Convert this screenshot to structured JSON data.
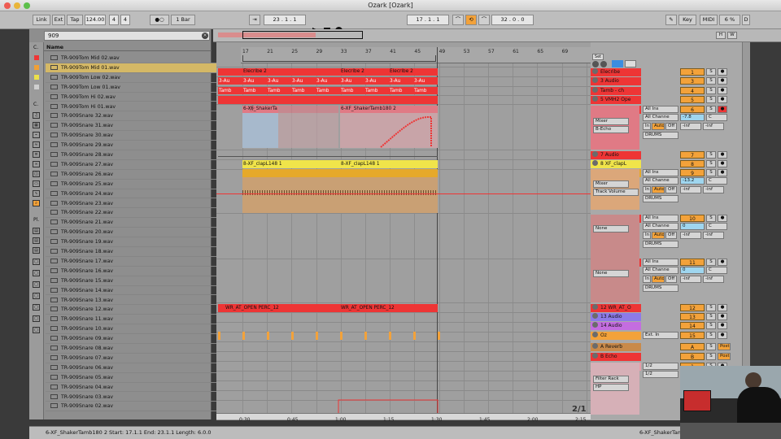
{
  "window": {
    "title": "Ozark  [Ozark]"
  },
  "control": {
    "link": "Link",
    "ext": "Ext",
    "tap": "Tap",
    "tempo": "124.00",
    "sig_num": "4",
    "sig_den": "4",
    "quant": "1 Bar",
    "pos1": "23 . 1 . 1",
    "pos2": "17 . 1 . 1",
    "len": "32 . 0 . 0",
    "key": "Key",
    "midi": "MIDI",
    "cpu": "6 %",
    "cpu_d": "D"
  },
  "browser": {
    "search": "909",
    "header": "Name",
    "items": [
      "TR-909Tom Mid 02.wav",
      "TR-909Tom Mid 01.wav",
      "TR-909Tom Low 02.wav",
      "TR-909Tom Low 01.wav",
      "TR-909Tom Hi 02.wav",
      "TR-909Tom Hi 01.wav",
      "TR-909Snare 32.wav",
      "TR-909Snare 31.wav",
      "TR-909Snare 30.wav",
      "TR-909Snare 29.wav",
      "TR-909Snare 28.wav",
      "TR-909Snare 27.wav",
      "TR-909Snare 26.wav",
      "TR-909Snare 25.wav",
      "TR-909Snare 24.wav",
      "TR-909Snare 23.wav",
      "TR-909Snare 22.wav",
      "TR-909Snare 21.wav",
      "TR-909Snare 20.wav",
      "TR-909Snare 19.wav",
      "TR-909Snare 18.wav",
      "TR-909Snare 17.wav",
      "TR-909Snare 16.wav",
      "TR-909Snare 15.wav",
      "TR-909Snare 14.wav",
      "TR-909Snare 13.wav",
      "TR-909Snare 12.wav",
      "TR-909Snare 11.wav",
      "TR-909Snare 10.wav",
      "TR-909Snare 09.wav",
      "TR-909Snare 08.wav",
      "TR-909Snare 07.wav",
      "TR-909Snare 06.wav",
      "TR-909Snare 05.wav",
      "TR-909Snare 04.wav",
      "TR-909Snare 03.wav",
      "TR-909Snare 02.wav"
    ],
    "selected_index": 1,
    "cat_c": "C.",
    "cat_p": "Pl."
  },
  "ruler": {
    "bars": [
      "17",
      "21",
      "25",
      "29",
      "33",
      "37",
      "41",
      "45",
      "49",
      "53",
      "57",
      "61",
      "65",
      "69"
    ],
    "times": [
      "0:30",
      "0:45",
      "1:00",
      "1:15",
      "1:30",
      "1:45",
      "2:00",
      "2:15"
    ],
    "page": "2/1"
  },
  "clips": {
    "elecribe": "Elecribe 2",
    "audio3": "3-Au",
    "tamb": "Tamb",
    "shaker": "6-XF_ShakerTa",
    "shaker2": "6-XF_ShakerTamb180 2",
    "clap": "8-XF_clapL148 1",
    "wr": "WR_AT_OPEN PERC_12"
  },
  "tracks": [
    {
      "name": "Elecribe",
      "color": "#ee3535"
    },
    {
      "name": "3 Audio",
      "color": "#ee3535"
    },
    {
      "name": "Tamb - ch",
      "color": "#ee3535"
    },
    {
      "name": "5 VMH2 Ope",
      "color": "#ee3535"
    },
    {
      "name": "6 XF_Shaker",
      "color": "#ee3535"
    },
    {
      "name": "7 Audio",
      "color": "#ee3535"
    },
    {
      "name": "8 XF_clapL",
      "color": "#f0e44a"
    },
    {
      "name": "9 tth_hat_9",
      "color": "#e6a92a"
    },
    {
      "name": "10 TR-909To",
      "color": "#ee3535"
    },
    {
      "name": "11 TR-909To",
      "color": "#ee3535"
    },
    {
      "name": "12 WR_AT_O",
      "color": "#ee3535"
    },
    {
      "name": "13 Audio",
      "color": "#8d7ae8"
    },
    {
      "name": "14 Audio",
      "color": "#c46de0"
    },
    {
      "name": "Oz",
      "color": "#f3a23a"
    },
    {
      "name": "A Reverb",
      "color": "#c98a4a"
    },
    {
      "name": "B Echo",
      "color": "#ee3535"
    },
    {
      "name": "Master",
      "color": "#e89ca8"
    }
  ],
  "mixer": {
    "set": "Set",
    "all_ins": "All Ins",
    "all_chan": "All Channe",
    "mixer": "Mixer",
    "b_echo": "B-Echo",
    "in": "In",
    "auto": "Auto",
    "off": "Off",
    "drums": "DRUMS",
    "none": "None",
    "track_volume": "Track Volume",
    "ext_in": "Ext. In",
    "filter_rack": "Filter Rack",
    "hp": "HP",
    "half": "1/2",
    "vol_6": "-7.8",
    "vol_9": "-13.2",
    "inf": "-inf",
    "zero": "0",
    "c": "C",
    "s": "S",
    "post": "Post",
    "nums": [
      "1",
      "3",
      "4",
      "5",
      "6",
      "7",
      "8",
      "9",
      "10",
      "11",
      "12",
      "13",
      "14",
      "15",
      "A",
      "B"
    ]
  },
  "status": {
    "text": "6-XF_ShakerTamb180 2  Start: 17.1.1  End: 23.1.1  Length: 6.0.0",
    "track": "6-XF_ShakerTamb180 2"
  }
}
